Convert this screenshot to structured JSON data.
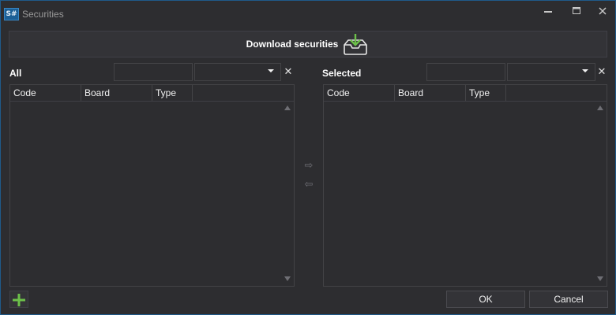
{
  "window": {
    "title": "Securities",
    "icon": "app-logo-icon",
    "icon_text": "S#",
    "controls": [
      "minimize-icon",
      "maximize-icon",
      "close-icon"
    ]
  },
  "toolbar": {
    "download_label": "Download securities",
    "download_icon": "download-tray-icon"
  },
  "all_panel": {
    "label": "All",
    "search_value": "",
    "type_filter_value": "",
    "clear_symbol": "✕",
    "columns": [
      "Code",
      "Board",
      "Type"
    ],
    "rows": []
  },
  "selected_panel": {
    "label": "Selected",
    "search_value": "",
    "type_filter_value": "",
    "clear_symbol": "✕",
    "columns": [
      "Code",
      "Board",
      "Type"
    ],
    "rows": []
  },
  "transfer": {
    "add_symbol": "⇨",
    "remove_symbol": "⇦"
  },
  "footer": {
    "ok_label": "OK",
    "cancel_label": "Cancel",
    "add_icon": "plus-icon"
  },
  "colors": {
    "background": "#2d2d30",
    "accent_green": "#6cc04a",
    "border": "#434346",
    "window_border": "#1f5a8a"
  }
}
